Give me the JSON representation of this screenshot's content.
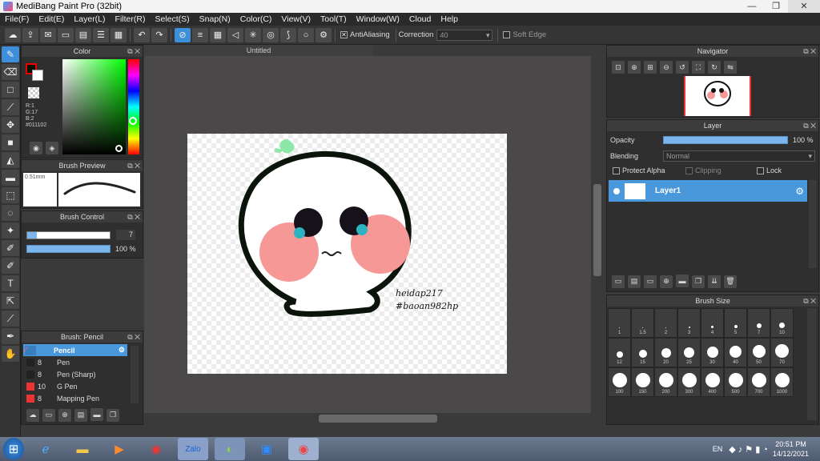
{
  "window": {
    "title": "MediBang Paint Pro (32bit)"
  },
  "menu": [
    "File(F)",
    "Edit(E)",
    "Layer(L)",
    "Filter(R)",
    "Select(S)",
    "Snap(N)",
    "Color(C)",
    "View(V)",
    "Tool(T)",
    "Window(W)",
    "Cloud",
    "Help"
  ],
  "toolbar": {
    "antialiasing": "AntiAliasing",
    "correction_label": "Correction",
    "correction_value": "40",
    "soft_edge": "Soft Edge"
  },
  "color_panel": {
    "title": "Color",
    "r": "R:1",
    "g": "G:17",
    "b": "B:2",
    "hex": "#011102",
    "fg_color": "#011102"
  },
  "brush_preview": {
    "title": "Brush Preview",
    "size": "0.51mm"
  },
  "brush_control": {
    "title": "Brush Control",
    "size_value": "7",
    "opacity_value": "100 %"
  },
  "brush_list": {
    "title": "Brush: Pencil",
    "items": [
      {
        "size": "",
        "name": "Pencil",
        "selected": true
      },
      {
        "size": "8",
        "name": "Pen"
      },
      {
        "size": "8",
        "name": "Pen (Sharp)"
      },
      {
        "size": "10",
        "name": "G Pen"
      },
      {
        "size": "8",
        "name": "Mapping Pen"
      }
    ]
  },
  "document": {
    "tab": "Untitled",
    "signature_line1": "heidap217",
    "signature_line2": "#baoan982hp"
  },
  "navigator": {
    "title": "Navigator"
  },
  "layer_panel": {
    "title": "Layer",
    "opacity_label": "Opacity",
    "opacity_value": "100 %",
    "opacity_fraction": 1.0,
    "blending_label": "Blending",
    "blending_value": "Normal",
    "protect_alpha": "Protect Alpha",
    "clipping": "Clipping",
    "lock": "Lock",
    "layer_name": "Layer1"
  },
  "brush_size": {
    "title": "Brush Size",
    "sizes": [
      "1",
      "1.5",
      "2",
      "3",
      "4",
      "5",
      "7",
      "10",
      "12",
      "15",
      "20",
      "25",
      "30",
      "40",
      "50",
      "70",
      "100",
      "150",
      "200",
      "300",
      "400",
      "500",
      "700",
      "1000"
    ]
  },
  "taskbar": {
    "lang": "EN",
    "time": "20:51 PM",
    "date": "14/12/2021"
  }
}
